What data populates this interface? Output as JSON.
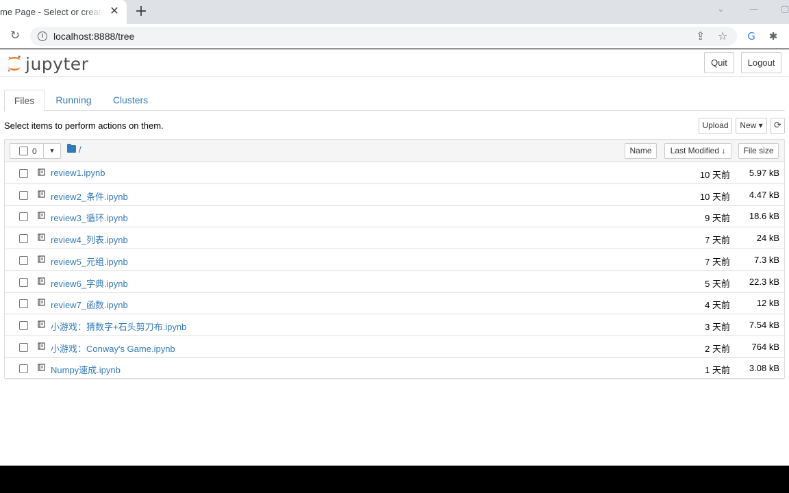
{
  "browser": {
    "tab_title": "me Page - Select or create a",
    "close_glyph": "✕",
    "new_tab_glyph": "+",
    "reload_glyph": "↻",
    "url": "localhost:8888/tree"
  },
  "header": {
    "logo_text": "jupyter",
    "quit_label": "Quit",
    "logout_label": "Logout"
  },
  "tabs": [
    {
      "label": "Files",
      "active": true
    },
    {
      "label": "Running",
      "active": false
    },
    {
      "label": "Clusters",
      "active": false
    }
  ],
  "toolbar": {
    "hint": "Select items to perform actions on them.",
    "upload_label": "Upload",
    "new_label": "New ▾",
    "refresh_glyph": "⟳"
  },
  "list_header": {
    "selected_count": "0",
    "breadcrumb": "/",
    "sort_name": "Name",
    "sort_modified": "Last Modified ↓",
    "sort_size": "File size"
  },
  "files": [
    {
      "name": "review1.ipynb",
      "modified": "10 天前",
      "size": "5.97 kB"
    },
    {
      "name": "review2_条件.ipynb",
      "modified": "10 天前",
      "size": "4.47 kB"
    },
    {
      "name": "review3_循环.ipynb",
      "modified": "9 天前",
      "size": "18.6 kB"
    },
    {
      "name": "review4_列表.ipynb",
      "modified": "7 天前",
      "size": "24 kB"
    },
    {
      "name": "review5_元组.ipynb",
      "modified": "7 天前",
      "size": "7.3 kB"
    },
    {
      "name": "review6_字典.ipynb",
      "modified": "5 天前",
      "size": "22.3 kB"
    },
    {
      "name": "review7_函数.ipynb",
      "modified": "4 天前",
      "size": "12 kB"
    },
    {
      "name": "小游戏：猜数字+石头剪刀布.ipynb",
      "modified": "3 天前",
      "size": "7.54 kB"
    },
    {
      "name": "小游戏：Conway's Game.ipynb",
      "modified": "2 天前",
      "size": "764 kB"
    },
    {
      "name": "Numpy速成.ipynb",
      "modified": "1 天前",
      "size": "3.08 kB"
    }
  ],
  "colors": {
    "link": "#337ab7",
    "logo_orange": "#f37726"
  }
}
